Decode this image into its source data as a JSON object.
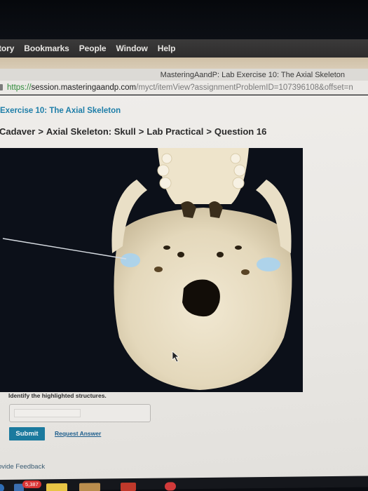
{
  "menubar": {
    "items": [
      "tory",
      "Bookmarks",
      "People",
      "Window",
      "Help"
    ]
  },
  "browser": {
    "window_title": "MasteringAandP: Lab Exercise 10: The Axial Skeleton",
    "url": {
      "protocol": "https://",
      "host": "session.masteringaandp.com",
      "path": "/myct/itemView?assignmentProblemID=107396108&offset=n"
    }
  },
  "page": {
    "exercise_title": "Exercise 10: The Axial Skeleton",
    "breadcrumb": [
      "Cadaver",
      "Axial Skeleton: Skull",
      "Lab Practical",
      "Question 16"
    ],
    "breadcrumb_separator": ">",
    "figure": {
      "subject": "Inferior view of skull with highlighted structures",
      "highlight_color": "#a9d3ee",
      "highlighted_count": 2
    },
    "question": "Identify the highlighted structures.",
    "answer": {
      "value": "",
      "placeholder": ""
    },
    "submit_label": "Submit",
    "request_answer_label": "Request Answer",
    "feedback_label": "ovide Feedback"
  },
  "dock": {
    "badge_count": "5,387"
  },
  "colors": {
    "accent": "#1b7a9e",
    "link": "#1c5d8c",
    "exercise_title": "#1e7ea8"
  }
}
